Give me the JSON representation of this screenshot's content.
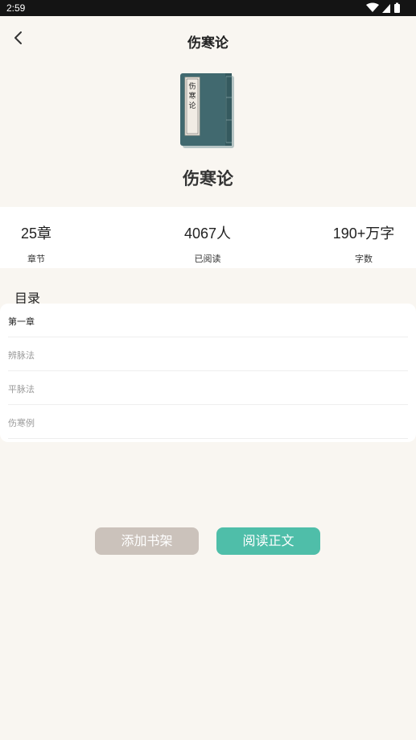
{
  "status_bar": {
    "time": "2:59"
  },
  "header": {
    "title": "伤寒论"
  },
  "book": {
    "name": "伤寒论",
    "cover_text": [
      "伤",
      "寒",
      "论"
    ]
  },
  "stats": [
    {
      "value": "25章",
      "label": "章节"
    },
    {
      "value": "4067人",
      "label": "已阅读"
    },
    {
      "value": "190+万字",
      "label": "字数"
    }
  ],
  "toc": {
    "title": "目录",
    "chapters": [
      {
        "label": "第一章",
        "color": "#222222"
      },
      {
        "label": "辨脉法",
        "color": "#9a9a9a"
      },
      {
        "label": "平脉法",
        "color": "#9a9a9a"
      },
      {
        "label": "伤寒例",
        "color": "#9a9a9a"
      }
    ]
  },
  "actions": {
    "add_shelf_label": "添加书架",
    "read_label": "阅读正文"
  },
  "colors": {
    "accent": "#4fbea9",
    "secondary_button": "#cbc2bb",
    "background": "#f9f6f1"
  }
}
